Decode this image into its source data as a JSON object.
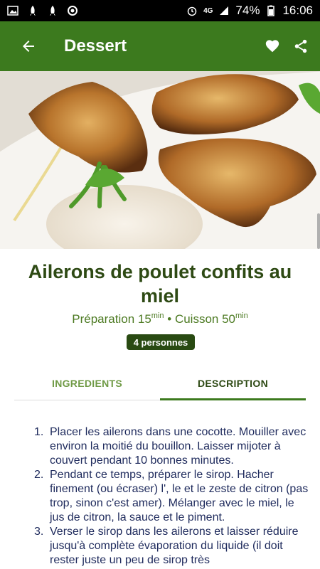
{
  "status_bar": {
    "network": "4G",
    "battery": "74%",
    "time": "16:06"
  },
  "app_bar": {
    "title": "Dessert"
  },
  "recipe": {
    "title": "Ailerons de poulet confits au miel",
    "prep_label": "Préparation 15",
    "prep_unit": "min",
    "separator": " • ",
    "cook_label": "Cuisson 50",
    "cook_unit": "min",
    "servings": "4 personnes"
  },
  "tabs": [
    {
      "label": "INGREDIENTS",
      "active": false
    },
    {
      "label": "DESCRIPTION",
      "active": true
    }
  ],
  "steps": [
    {
      "num": "1.",
      "text": "Placer les ailerons dans une cocotte. Mouiller avec environ la moitié du bouillon. Laisser mijoter à couvert pendant 10 bonnes minutes."
    },
    {
      "num": "2.",
      "text": "Pendant ce temps, préparer le sirop. Hacher finement (ou écraser) l', le et le zeste de citron (pas trop, sinon c'est amer). Mélanger avec le miel, le jus de citron, la sauce et le piment."
    },
    {
      "num": "3.",
      "text": "Verser le sirop dans les ailerons et laisser réduire jusqu'à complète évaporation du liquide (il doit rester juste un peu de sirop très"
    }
  ],
  "colors": {
    "app_bar": "#3c7a1e",
    "title_text": "#2e4a14",
    "badge_bg": "#294a12",
    "step_text": "#1e2a5c"
  }
}
